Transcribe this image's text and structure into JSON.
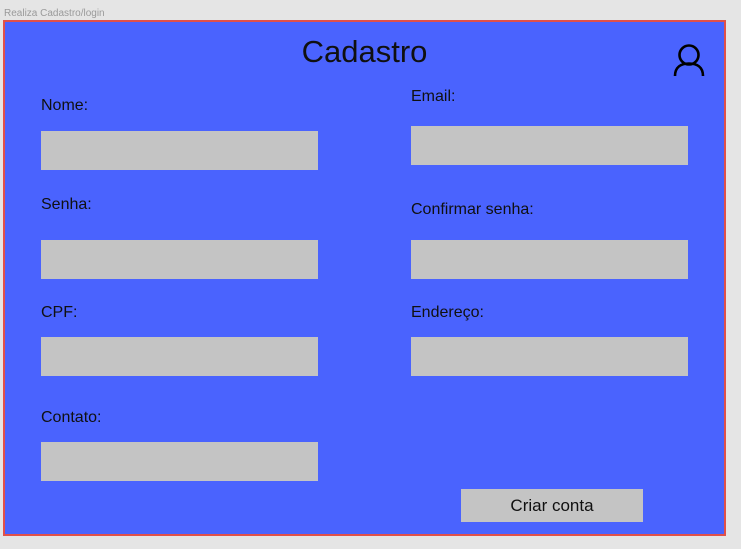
{
  "frame_label": "Realiza Cadastro/login",
  "title": "Cadastro",
  "icons": {
    "user": "user-icon"
  },
  "colors": {
    "background": "#4a63fe",
    "border": "#e0504a",
    "input": "#c4c4c4"
  },
  "fields": {
    "nome": {
      "label": "Nome:",
      "value": ""
    },
    "email": {
      "label": "Email:",
      "value": ""
    },
    "senha": {
      "label": "Senha:",
      "value": ""
    },
    "confirmar_senha": {
      "label": "Confirmar senha:",
      "value": ""
    },
    "cpf": {
      "label": "CPF:",
      "value": ""
    },
    "endereco": {
      "label": "Endereço:",
      "value": ""
    },
    "contato": {
      "label": "Contato:",
      "value": ""
    }
  },
  "submit_label": "Criar conta"
}
